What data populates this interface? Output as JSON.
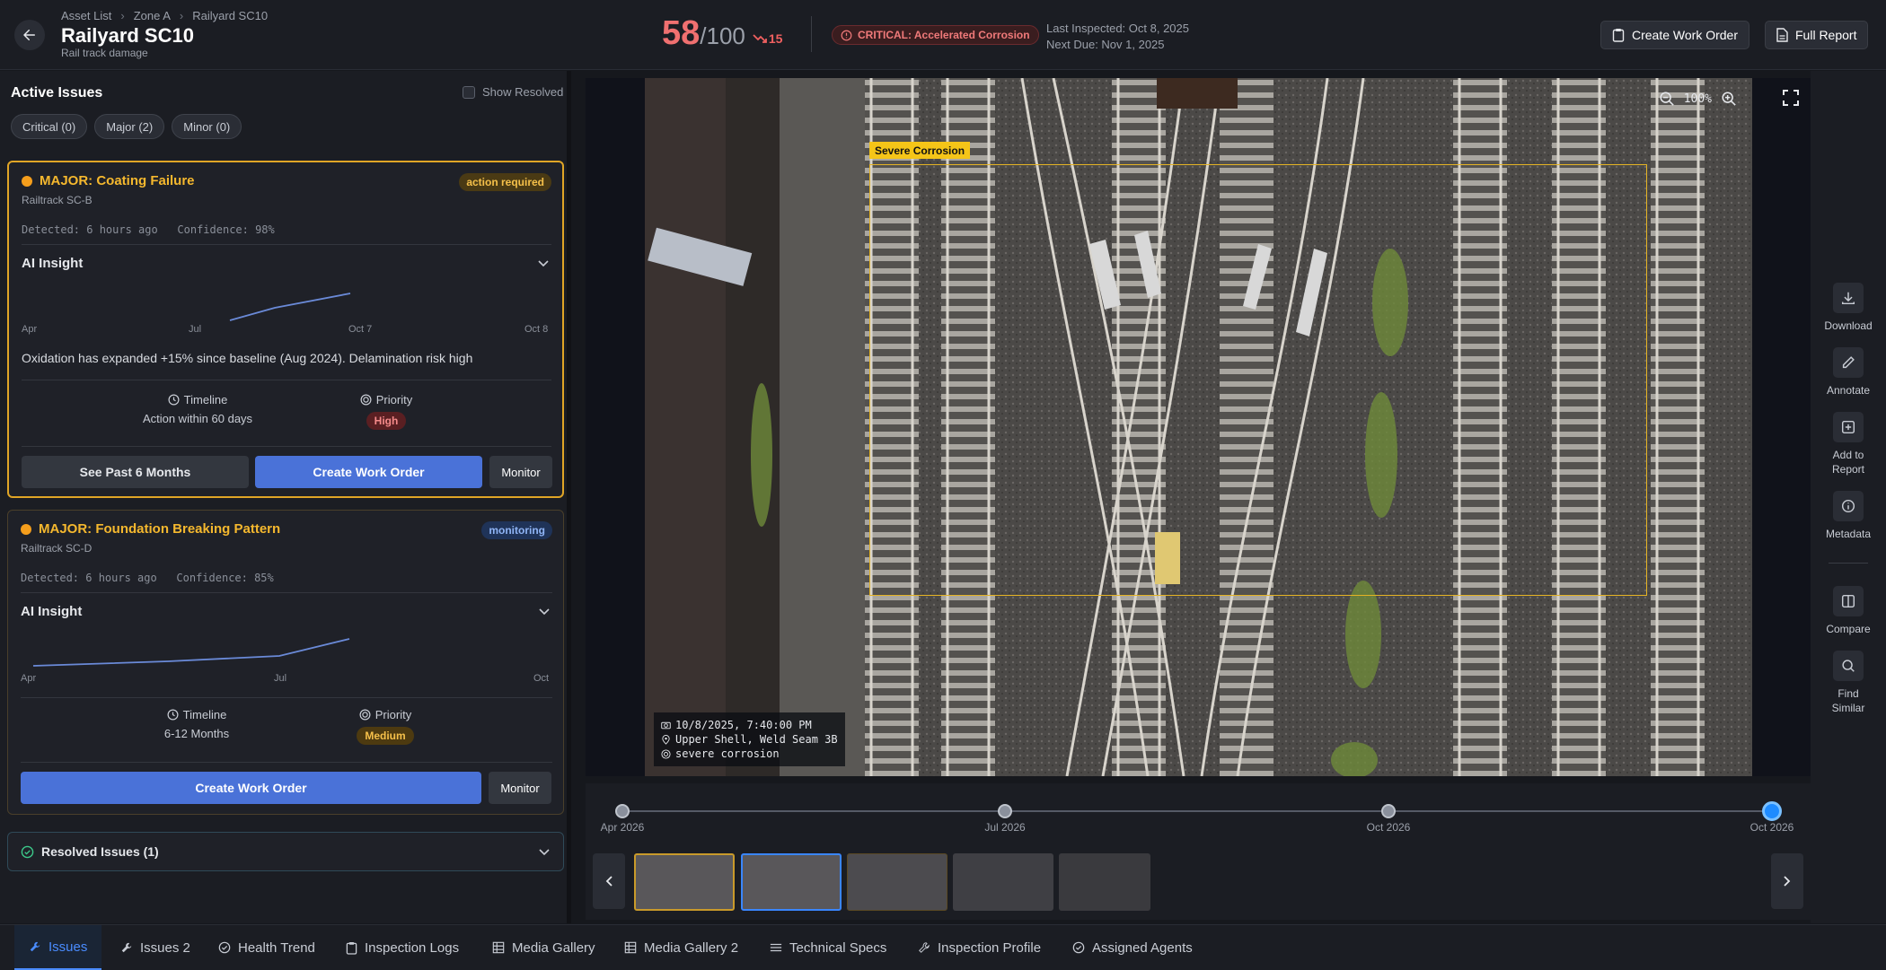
{
  "header": {
    "breadcrumb": [
      "Asset List",
      "Zone A",
      "Railyard SC10"
    ],
    "title": "Railyard SC10",
    "subtitle": "Rail track damage",
    "score": "58",
    "score_max": "/100",
    "score_delta": "15",
    "critical_label": "CRITICAL: Accelerated Corrosion",
    "last_inspected": "Last Inspected: Oct 8, 2025",
    "next_due": "Next Due: Nov 1, 2025",
    "create_work_order": "Create Work Order",
    "full_report": "Full Report"
  },
  "issues": {
    "title": "Active Issues",
    "show_resolved": "Show Resolved",
    "filters": [
      "Critical (0)",
      "Major (2)",
      "Minor (0)"
    ],
    "cards": [
      {
        "title": "MAJOR: Coating Failure",
        "location": "Railtrack SC-B",
        "badge": "action required",
        "detected": "Detected: 6 hours ago   Confidence: 98%",
        "ai_label": "AI Insight",
        "trend_labels": [
          "Apr",
          "Jul",
          "Oct 7",
          "Oct 8"
        ],
        "insight": "Oxidation has expanded +15% since baseline (Aug 2024). Delamination risk high",
        "timeline_label": "Timeline",
        "timeline_value": "Action within 60 days",
        "priority_label": "Priority",
        "priority_value": "High",
        "btn_past": "See Past 6 Months",
        "btn_create": "Create Work Order",
        "btn_monitor": "Monitor"
      },
      {
        "title": "MAJOR: Foundation Breaking Pattern",
        "location": "Railtrack SC-D",
        "badge": "monitoring",
        "detected": "Detected: 6 hours ago   Confidence: 85%",
        "ai_label": "AI Insight",
        "trend_labels": [
          "Apr",
          "Jul",
          "Oct"
        ],
        "timeline_label": "Timeline",
        "timeline_value": "6-12 Months",
        "priority_label": "Priority",
        "priority_value": "Medium",
        "btn_create": "Create Work Order",
        "btn_monitor": "Monitor"
      }
    ],
    "resolved": "Resolved Issues (1)"
  },
  "viewer": {
    "detection_label": "Severe Corrosion",
    "zoom": "100%",
    "overlay_time": "10/8/2025, 7:40:00 PM",
    "overlay_location": "Upper Shell, Weld Seam 3B",
    "overlay_type": "severe corrosion"
  },
  "rail": {
    "download": "Download",
    "annotate": "Annotate",
    "add_to_report": "Add to Report",
    "metadata": "Metadata",
    "compare": "Compare",
    "find_similar": "Find Similar"
  },
  "timeline": {
    "labels": [
      "Apr 2026",
      "Jul 2026",
      "Oct 2026",
      "Oct 2026"
    ]
  },
  "tabs": [
    "Issues",
    "Issues 2",
    "Health Trend",
    "Inspection Logs",
    "Media Gallery",
    "Media Gallery 2",
    "Technical Specs",
    "Inspection Profile",
    "Assigned Agents"
  ],
  "colors": {
    "accent_blue": "#4a72d8",
    "critical_red": "#f07070",
    "major_orange": "#f5b82e",
    "detection_yellow": "#e4b324"
  }
}
